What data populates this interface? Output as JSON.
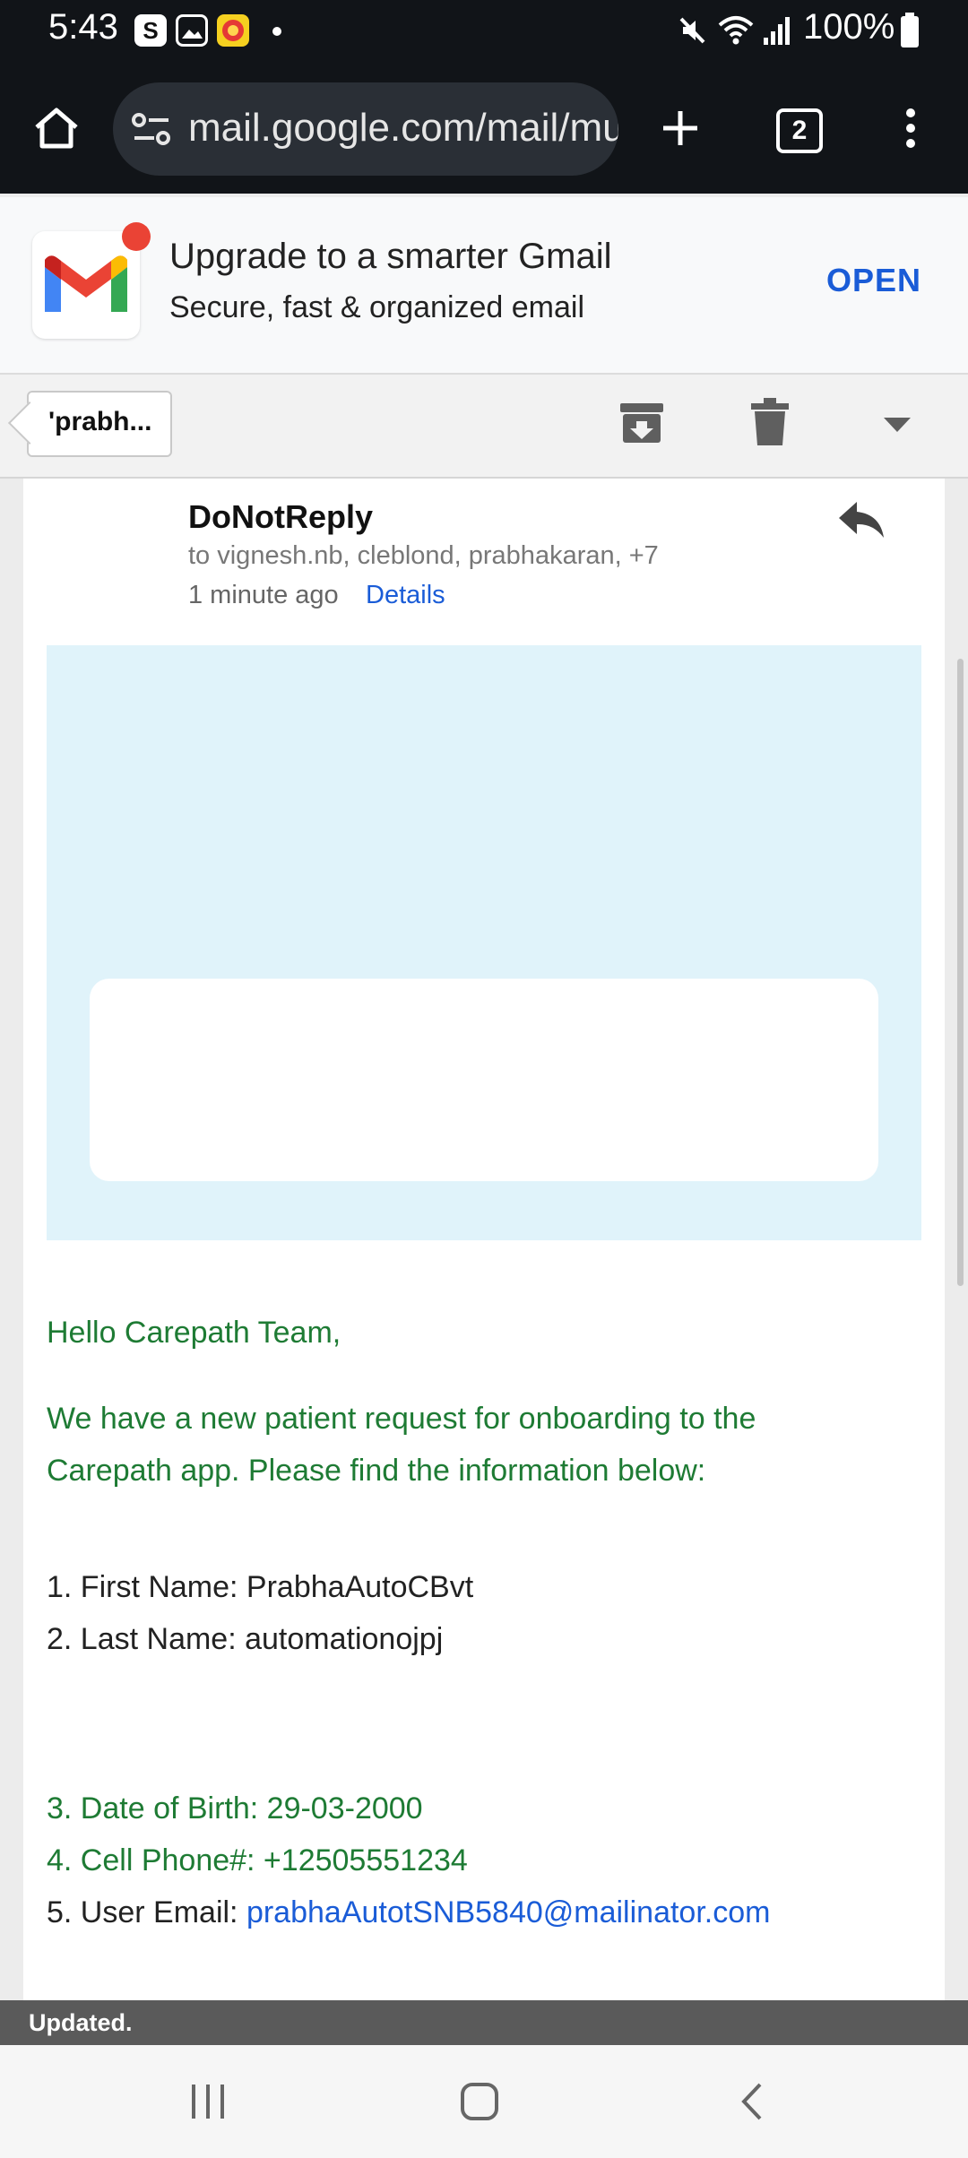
{
  "status_bar": {
    "time": "5:43",
    "notification_icons": [
      "s-app-icon",
      "gallery-icon",
      "app-badge-icon"
    ],
    "system_icons": [
      "mute-icon",
      "wifi-icon",
      "signal-icon"
    ],
    "battery": "100%"
  },
  "browser": {
    "url": "mail.google.com/mail/mu",
    "tab_count": "2"
  },
  "banner": {
    "title": "Upgrade to a smarter Gmail",
    "subtitle": "Secure, fast & organized email",
    "open_label": "OPEN"
  },
  "action_bar": {
    "back_label": "'prabh..."
  },
  "email": {
    "sender": "DoNotReply",
    "recipients": "to vignesh.nb, cleblond, prabhakaran, +7",
    "time_ago": "1 minute ago",
    "details_label": "Details",
    "greeting": "Hello Carepath Team,",
    "intro_line1": "We have a new patient request for onboarding to the",
    "intro_line2": "Carepath app. Please find the information below:",
    "first_name": "1. First Name: PrabhaAutoCBvt",
    "last_name": "2. Last Name: automationojpj",
    "dob": "3. Date of Birth: 29-03-2000",
    "phone": "4. Cell Phone#: +12505551234",
    "user_email_label": "5. User Email: ",
    "user_email": "prabhaAutotSNB5840@mailinator.com"
  },
  "toast": {
    "message": "Updated."
  },
  "colors": {
    "accent_blue": "#1a5cd7",
    "body_green": "#1e7b34",
    "hero_bg": "#e0f3fa",
    "dark_chrome": "#111418"
  }
}
